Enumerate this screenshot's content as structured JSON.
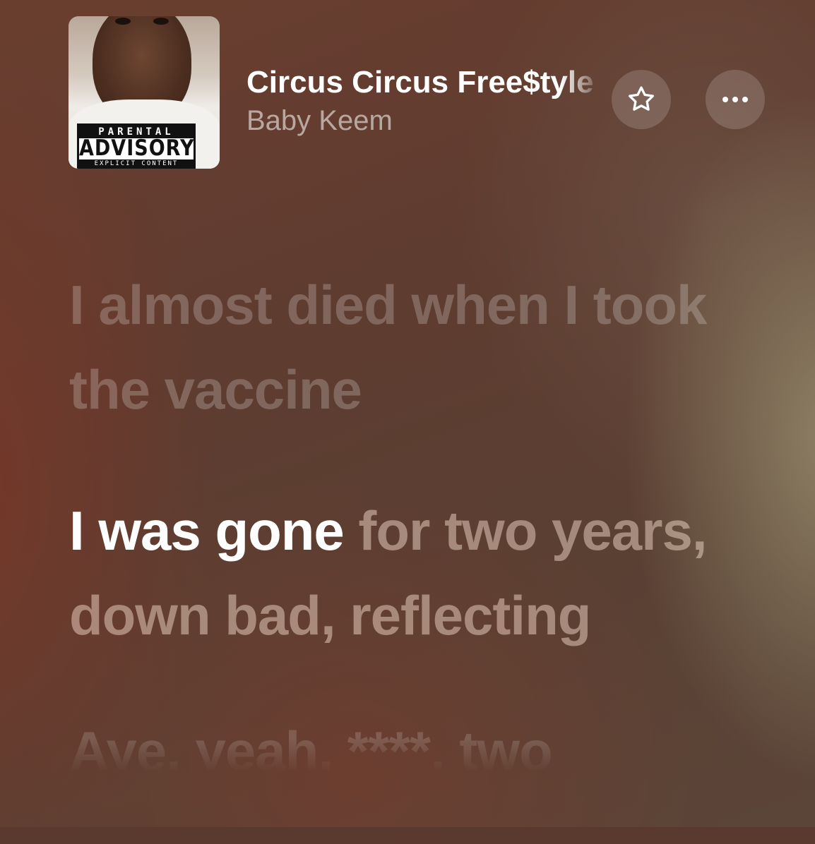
{
  "now_playing": {
    "title": "Circus Circus Free$tyle",
    "artist": "Baby Keem",
    "artwork": {
      "label_top": "PARENTAL",
      "label_main": "ADVISORY",
      "label_bottom": "EXPLICIT CONTENT"
    },
    "actions": {
      "favorite_icon": "star-outline-icon",
      "more_icon": "ellipsis-icon"
    }
  },
  "lyrics": [
    {
      "text": "I almost died when I took the vaccine",
      "state": "past"
    },
    {
      "sung": "I was gone",
      "remaining": " for two years, down bad, reflecting",
      "state": "current"
    },
    {
      "text": "Aye, yeah, ****, two",
      "state": "upcoming"
    }
  ],
  "colors": {
    "background": "#5a3a2e",
    "active_lyric": "#ffffff"
  }
}
